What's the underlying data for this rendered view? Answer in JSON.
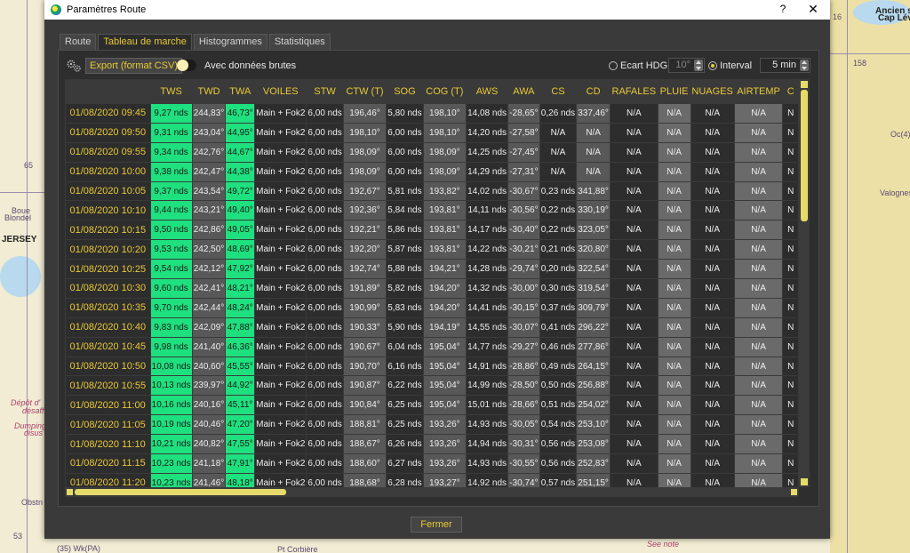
{
  "window": {
    "title": "Paramètres Route",
    "help_label": "?",
    "close_label": "✕"
  },
  "tabs": [
    "Route",
    "Tableau de marche",
    "Histogrammes",
    "Statistiques"
  ],
  "active_tab": "Tableau de marche",
  "toolbar": {
    "export_label": "Export (format CSV)",
    "raw_data_label": "Avec données brutes",
    "raw_data_on": false,
    "ecart_hdg_label": "Ecart HDG",
    "ecart_hdg_value": "10°",
    "interval_label": "Interval",
    "interval_value": "5 min",
    "selected_mode": "Interval"
  },
  "table": {
    "columns": [
      "",
      "TWS",
      "TWD",
      "TWA",
      "VOILES",
      "STW",
      "CTW (T)",
      "SOG",
      "COG (T)",
      "AWS",
      "AWA",
      "CS",
      "CD",
      "RAFALES",
      "PLUIE",
      "NUAGES",
      "AIRTEMP",
      "C"
    ],
    "rows": [
      [
        "01/08/2020 09:45",
        "9,27 nds",
        "244,83°",
        "46,73°",
        "Main + Fok2",
        "6,00 nds",
        "196,46°",
        "5,80 nds",
        "198,10°",
        "14,08 nds",
        "-28,65°",
        "0,26 nds",
        "337,46°",
        "N/A",
        "N/A",
        "N/A",
        "N/A",
        "N"
      ],
      [
        "01/08/2020 09:50",
        "9,31 nds",
        "243,04°",
        "44,95°",
        "Main + Fok2",
        "6,00 nds",
        "198,10°",
        "6,00 nds",
        "198,10°",
        "14,20 nds",
        "-27,58°",
        "N/A",
        "N/A",
        "N/A",
        "N/A",
        "N/A",
        "N/A",
        "N"
      ],
      [
        "01/08/2020 09:55",
        "9,34 nds",
        "242,76°",
        "44,67°",
        "Main + Fok2",
        "6,00 nds",
        "198,09°",
        "6,00 nds",
        "198,09°",
        "14,25 nds",
        "-27,45°",
        "N/A",
        "N/A",
        "N/A",
        "N/A",
        "N/A",
        "N/A",
        "N"
      ],
      [
        "01/08/2020 10:00",
        "9,38 nds",
        "242,47°",
        "44,38°",
        "Main + Fok2",
        "6,00 nds",
        "198,09°",
        "6,00 nds",
        "198,09°",
        "14,29 nds",
        "-27,31°",
        "N/A",
        "N/A",
        "N/A",
        "N/A",
        "N/A",
        "N/A",
        "N"
      ],
      [
        "01/08/2020 10:05",
        "9,37 nds",
        "243,54°",
        "49,72°",
        "Main + Fok2",
        "6,00 nds",
        "192,67°",
        "5,81 nds",
        "193,82°",
        "14,02 nds",
        "-30,67°",
        "0,23 nds",
        "341,88°",
        "N/A",
        "N/A",
        "N/A",
        "N/A",
        "N"
      ],
      [
        "01/08/2020 10:10",
        "9,44 nds",
        "243,21°",
        "49,40°",
        "Main + Fok2",
        "6,00 nds",
        "192,36°",
        "5,84 nds",
        "193,81°",
        "14,11 nds",
        "-30,56°",
        "0,22 nds",
        "330,19°",
        "N/A",
        "N/A",
        "N/A",
        "N/A",
        "N"
      ],
      [
        "01/08/2020 10:15",
        "9,50 nds",
        "242,86°",
        "49,05°",
        "Main + Fok2",
        "6,00 nds",
        "192,21°",
        "5,86 nds",
        "193,81°",
        "14,17 nds",
        "-30,40°",
        "0,22 nds",
        "323,05°",
        "N/A",
        "N/A",
        "N/A",
        "N/A",
        "N"
      ],
      [
        "01/08/2020 10:20",
        "9,53 nds",
        "242,50°",
        "48,69°",
        "Main + Fok2",
        "6,00 nds",
        "192,20°",
        "5,87 nds",
        "193,81°",
        "14,22 nds",
        "-30,21°",
        "0,21 nds",
        "320,80°",
        "N/A",
        "N/A",
        "N/A",
        "N/A",
        "N"
      ],
      [
        "01/08/2020 10:25",
        "9,54 nds",
        "242,12°",
        "47,92°",
        "Main + Fok2",
        "6,00 nds",
        "192,74°",
        "5,88 nds",
        "194,21°",
        "14,28 nds",
        "-29,74°",
        "0,20 nds",
        "322,54°",
        "N/A",
        "N/A",
        "N/A",
        "N/A",
        "N"
      ],
      [
        "01/08/2020 10:30",
        "9,60 nds",
        "242,41°",
        "48,21°",
        "Main + Fok2",
        "6,00 nds",
        "191,89°",
        "5,82 nds",
        "194,20°",
        "14,32 nds",
        "-30,00°",
        "0,30 nds",
        "319,54°",
        "N/A",
        "N/A",
        "N/A",
        "N/A",
        "N"
      ],
      [
        "01/08/2020 10:35",
        "9,70 nds",
        "242,44°",
        "48,24°",
        "Main + Fok2",
        "6,00 nds",
        "190,99°",
        "5,83 nds",
        "194,20°",
        "14,41 nds",
        "-30,15°",
        "0,37 nds",
        "309,79°",
        "N/A",
        "N/A",
        "N/A",
        "N/A",
        "N"
      ],
      [
        "01/08/2020 10:40",
        "9,83 nds",
        "242,09°",
        "47,88°",
        "Main + Fok2",
        "6,00 nds",
        "190,33°",
        "5,90 nds",
        "194,19°",
        "14,55 nds",
        "-30,07°",
        "0,41 nds",
        "296,22°",
        "N/A",
        "N/A",
        "N/A",
        "N/A",
        "N"
      ],
      [
        "01/08/2020 10:45",
        "9,98 nds",
        "241,40°",
        "46,36°",
        "Main + Fok2",
        "6,00 nds",
        "190,67°",
        "6,04 nds",
        "195,04°",
        "14,77 nds",
        "-29,27°",
        "0,46 nds",
        "277,86°",
        "N/A",
        "N/A",
        "N/A",
        "N/A",
        "N"
      ],
      [
        "01/08/2020 10:50",
        "10,08 nds",
        "240,60°",
        "45,55°",
        "Main + Fok2",
        "6,00 nds",
        "190,70°",
        "6,16 nds",
        "195,04°",
        "14,91 nds",
        "-28,86°",
        "0,49 nds",
        "264,15°",
        "N/A",
        "N/A",
        "N/A",
        "N/A",
        "N"
      ],
      [
        "01/08/2020 10:55",
        "10,13 nds",
        "239,97°",
        "44,92°",
        "Main + Fok2",
        "6,00 nds",
        "190,87°",
        "6,22 nds",
        "195,04°",
        "14,99 nds",
        "-28,50°",
        "0,50 nds",
        "256,88°",
        "N/A",
        "N/A",
        "N/A",
        "N/A",
        "N"
      ],
      [
        "01/08/2020 11:00",
        "10,16 nds",
        "240,16°",
        "45,11°",
        "Main + Fok2",
        "6,00 nds",
        "190,84°",
        "6,25 nds",
        "195,04°",
        "15,01 nds",
        "-28,66°",
        "0,51 nds",
        "254,02°",
        "N/A",
        "N/A",
        "N/A",
        "N/A",
        "N"
      ],
      [
        "01/08/2020 11:05",
        "10,19 nds",
        "240,46°",
        "47,20°",
        "Main + Fok2",
        "6,00 nds",
        "188,81°",
        "6,25 nds",
        "193,26°",
        "14,93 nds",
        "-30,05°",
        "0,54 nds",
        "253,10°",
        "N/A",
        "N/A",
        "N/A",
        "N/A",
        "N"
      ],
      [
        "01/08/2020 11:10",
        "10,21 nds",
        "240,82°",
        "47,55°",
        "Main + Fok2",
        "6,00 nds",
        "188,67°",
        "6,26 nds",
        "193,26°",
        "14,94 nds",
        "-30,31°",
        "0,56 nds",
        "253,08°",
        "N/A",
        "N/A",
        "N/A",
        "N/A",
        "N"
      ],
      [
        "01/08/2020 11:15",
        "10,23 nds",
        "241,18°",
        "47,91°",
        "Main + Fok2",
        "6,00 nds",
        "188,60°",
        "6,27 nds",
        "193,26°",
        "14,93 nds",
        "-30,55°",
        "0,56 nds",
        "252,83°",
        "N/A",
        "N/A",
        "N/A",
        "N/A",
        "N"
      ],
      [
        "01/08/2020 11:20",
        "10,23 nds",
        "241,46°",
        "48,18°",
        "Main + Fok2",
        "6,00 nds",
        "188,68°",
        "6,28 nds",
        "193,27°",
        "14,92 nds",
        "-30,74°",
        "0,57 nds",
        "251,15°",
        "N/A",
        "N/A",
        "N/A",
        "N/A",
        "N"
      ]
    ]
  },
  "footer": {
    "close_label": "Fermer"
  },
  "background_chart": {
    "labels": [
      "Ancien sém",
      "Cap Lévi",
      "16",
      "158",
      "Oc(4)",
      "Valognes",
      "65",
      "Boue",
      "Blondel",
      "JERSEY",
      "Dépôt d'",
      "désaff",
      "Dumping",
      "disus",
      "Obstn",
      "53",
      "(35) Wk(PA)",
      "Pt Corbière",
      "See note"
    ]
  },
  "colors": {
    "accent": "#e8c936",
    "highlight_green": "#1ee07e",
    "dialog_bg": "#3a3a3a"
  }
}
